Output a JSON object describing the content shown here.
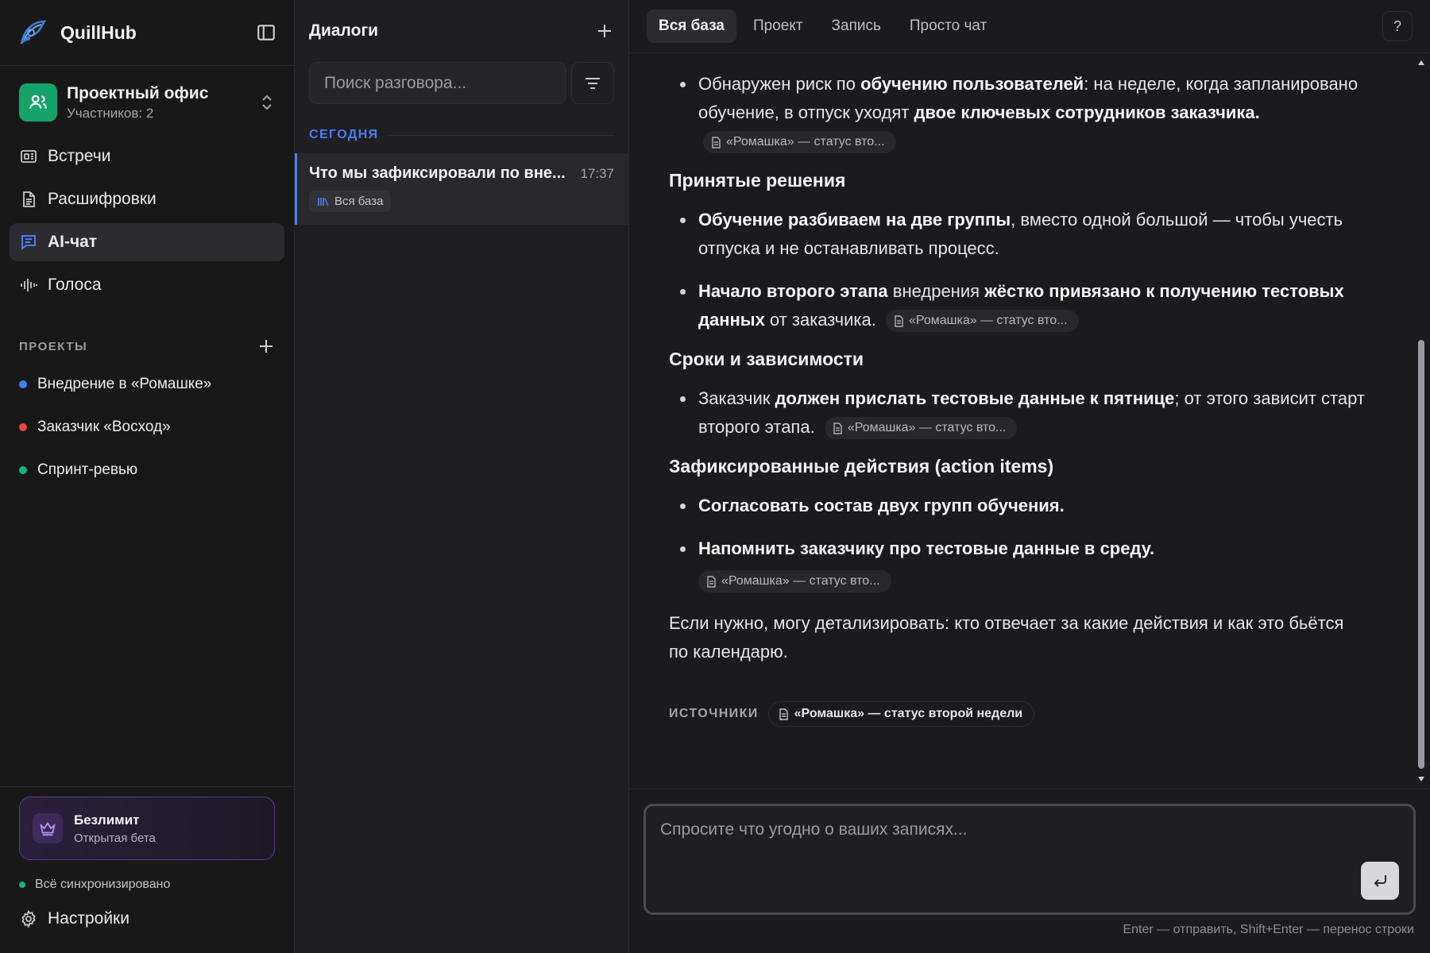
{
  "app": {
    "name": "QuillHub"
  },
  "workspace": {
    "name": "Проектный офис",
    "members": "Участников: 2"
  },
  "nav": [
    {
      "label": "Встречи",
      "icon": "meetings-icon"
    },
    {
      "label": "Расшифровки",
      "icon": "document-icon"
    },
    {
      "label": "AI-чат",
      "icon": "chat-icon",
      "active": true
    },
    {
      "label": "Голоса",
      "icon": "waveform-icon"
    }
  ],
  "projects": {
    "title": "ПРОЕКТЫ",
    "items": [
      {
        "label": "Внедрение в «Ромашке»",
        "color": "#3b82f6"
      },
      {
        "label": "Заказчик «Восход»",
        "color": "#ef4444"
      },
      {
        "label": "Спринт-ревью",
        "color": "#10b981"
      }
    ]
  },
  "plan": {
    "name": "Безлимит",
    "sub": "Открытая бета"
  },
  "sync": {
    "label": "Всё синхронизировано",
    "color": "#10b981"
  },
  "settings": {
    "label": "Настройки"
  },
  "dialogs": {
    "title": "Диалоги",
    "search_placeholder": "Поиск разговора...",
    "section": "СЕГОДНЯ",
    "items": [
      {
        "title": "Что мы зафиксировали по вне...",
        "time": "17:37",
        "tag": "Вся база"
      }
    ]
  },
  "tabs": [
    "Вся база",
    "Проект",
    "Запись",
    "Просто чат"
  ],
  "help": "?",
  "message": {
    "b1": {
      "t1": "Обнаружен риск по ",
      "b1": "обучению пользователей",
      "t2": ": на неделе, когда запланировано обучение, в отпуск уходят ",
      "b2": "двое ключевых сотрудников заказчика."
    },
    "h1": "Принятые решения",
    "b2": {
      "b1": "Обучение разбиваем на две группы",
      "t1": ", вместо одной большой — чтобы учесть отпуска и не останавливать процесс."
    },
    "b3": {
      "b1": "Начало второго этапа",
      "t1": " внедрения ",
      "b2": "жёстко привязано к получению тестовых данных",
      "t2": " от заказчика."
    },
    "h2": "Сроки и зависимости",
    "b4": {
      "t1": "Заказчик ",
      "b1": "должен прислать тестовые данные к пятнице",
      "t2": "; от этого зависит старт второго этапа."
    },
    "h3": "Зафиксированные действия (action items)",
    "b5": {
      "b1": "Согласовать состав двух групп обучения."
    },
    "b6": {
      "b1": "Напомнить заказчику про тестовые данные в среду."
    },
    "closing": "Если нужно, могу детализировать: кто отвечает за какие действия и как это бьётся по календарю.",
    "citation": "«Ромашка» — статус вто...",
    "sources_label": "ИСТОЧНИКИ",
    "source": "«Ромашка» — статус второй недели"
  },
  "composer": {
    "placeholder": "Спросите что угодно о ваших записях...",
    "hint": "Enter — отправить, Shift+Enter — перенос строки"
  }
}
